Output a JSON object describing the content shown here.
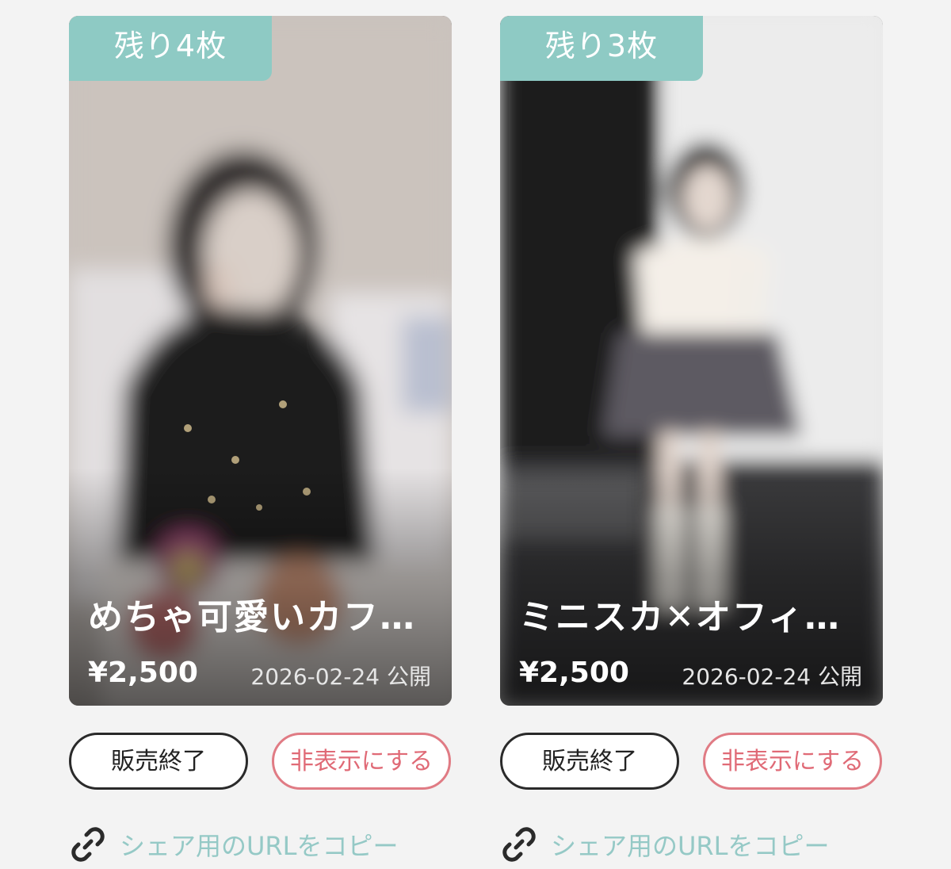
{
  "colors": {
    "badge_bg": "#8ecac4",
    "hide_button": "#e07b84",
    "share_link": "#95c9c6",
    "background": "#f3f3f3"
  },
  "items": [
    {
      "badge": "残り4枚",
      "title": "めちゃ可愛いカフ…",
      "price": "¥2,500",
      "date": "2026-02-24 公開",
      "end_label": "販売終了",
      "hide_label": "非表示にする",
      "share_label": "シェア用のURLをコピー",
      "share_icon": "link-icon"
    },
    {
      "badge": "残り3枚",
      "title": "ミニスカ✕オフィ…",
      "price": "¥2,500",
      "date": "2026-02-24 公開",
      "end_label": "販売終了",
      "hide_label": "非表示にする",
      "share_label": "シェア用のURLをコピー",
      "share_icon": "link-icon"
    }
  ]
}
